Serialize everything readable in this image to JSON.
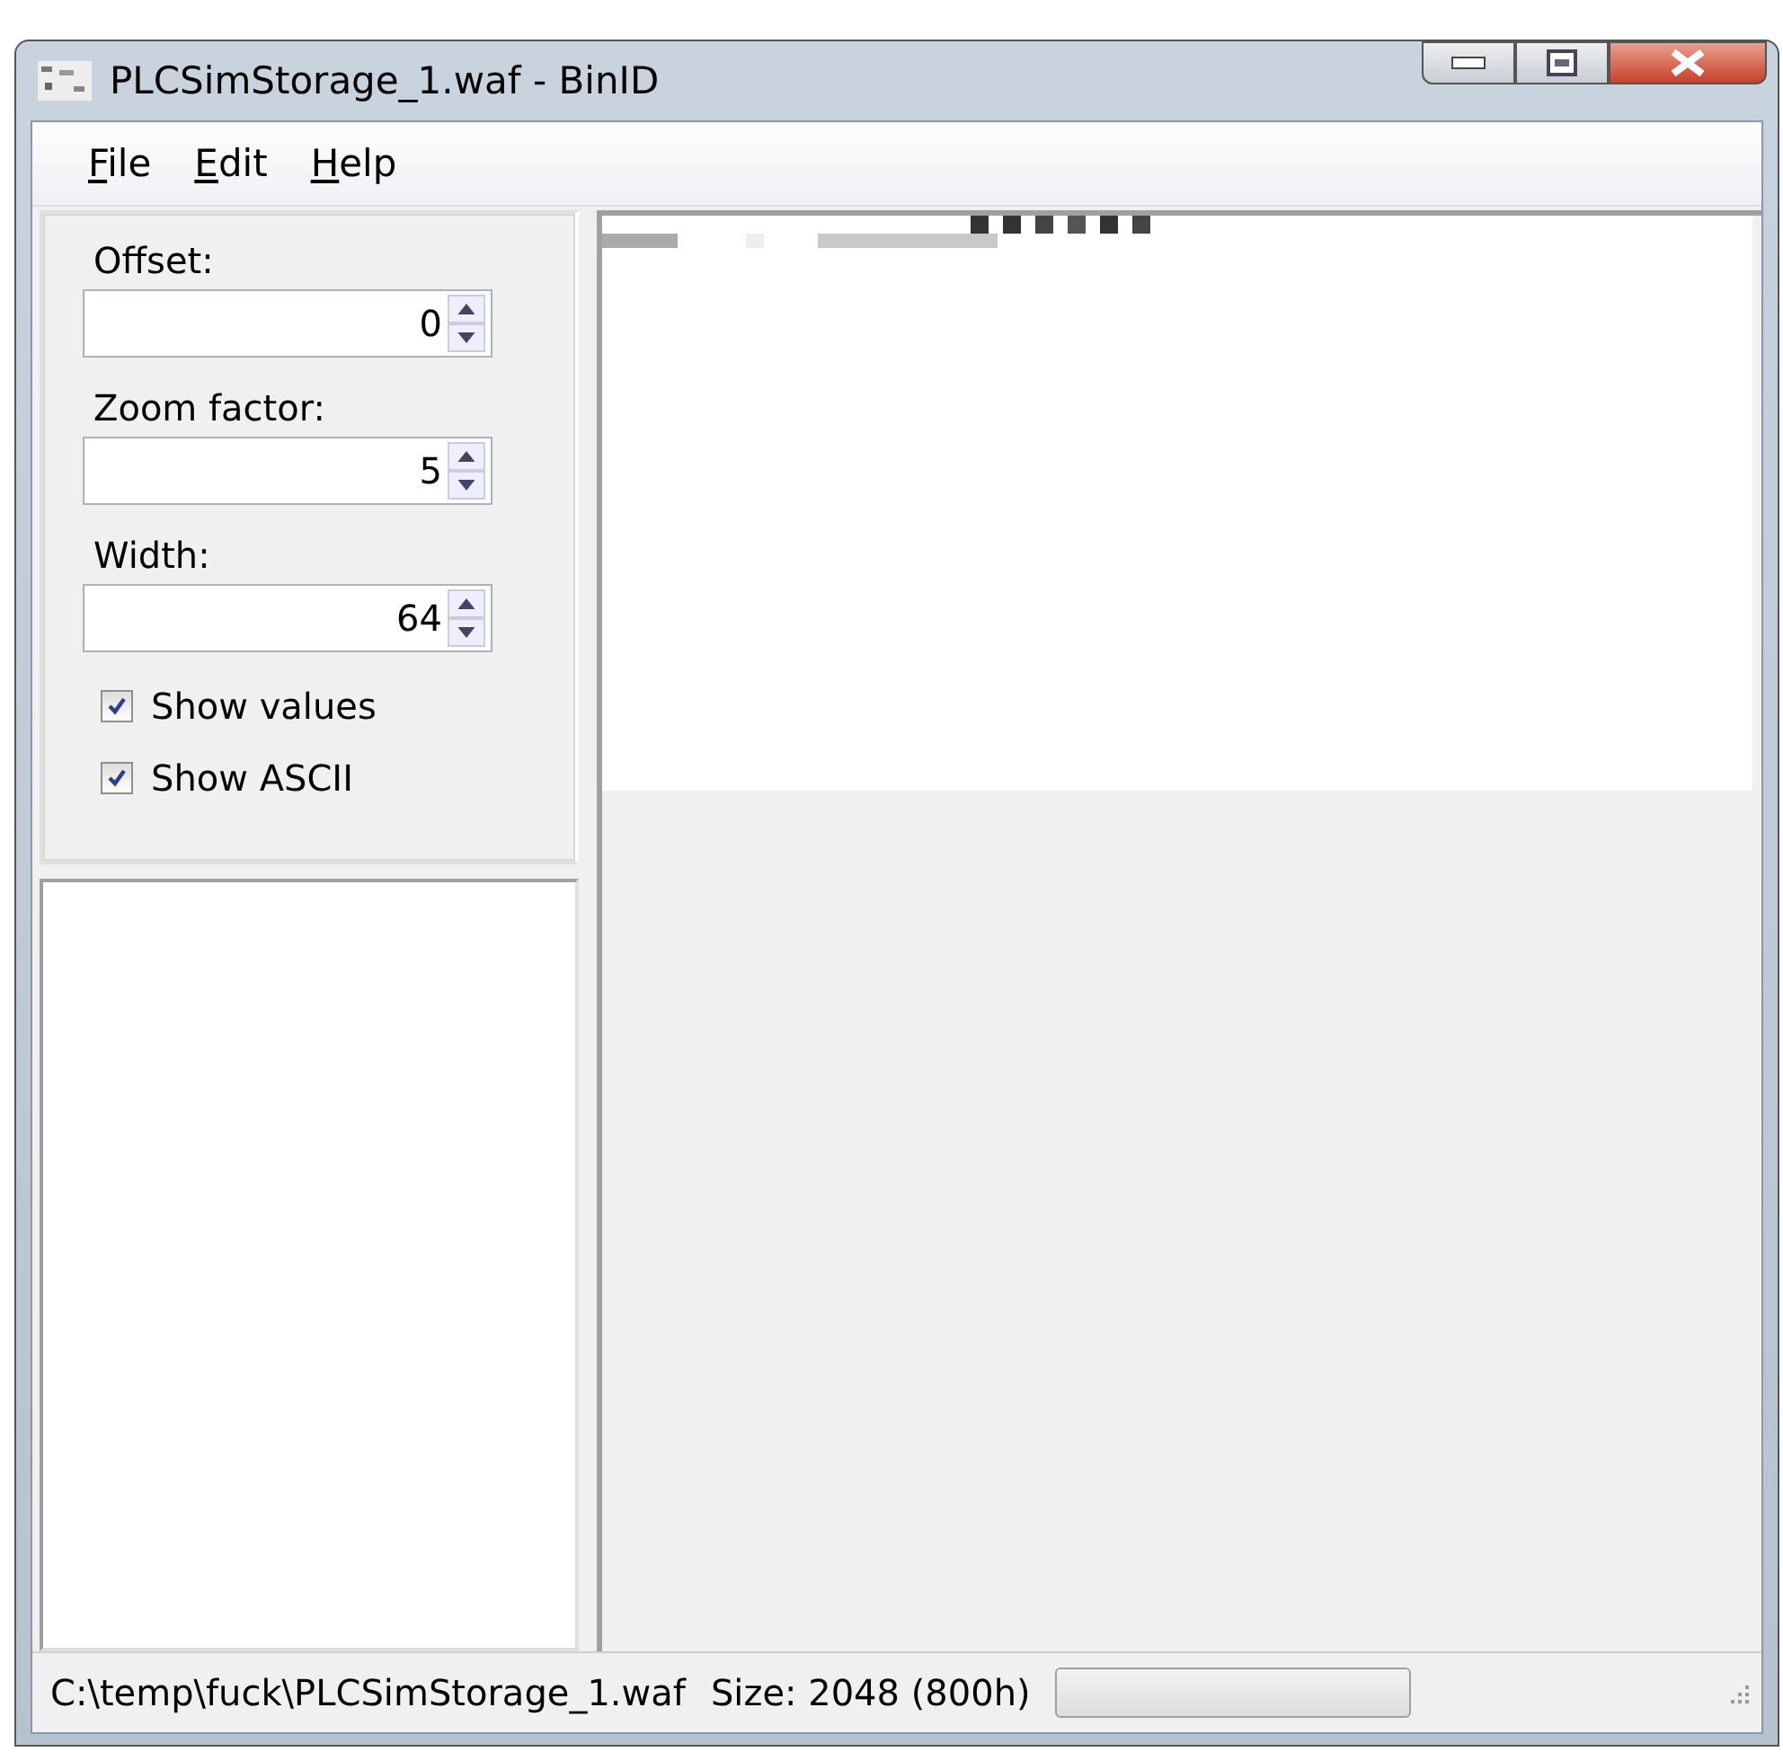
{
  "window": {
    "title": "PLCSimStorage_1.waf - BinID"
  },
  "menu": [
    {
      "label": "File"
    },
    {
      "label": "Edit"
    },
    {
      "label": "Help"
    }
  ],
  "settings": {
    "fields": [
      {
        "label": "Offset:",
        "value": "0"
      },
      {
        "label": "Zoom factor:",
        "value": "5"
      },
      {
        "label": "Width:",
        "value": "64"
      }
    ],
    "checkboxes": [
      {
        "label": "Show values",
        "checked": true
      },
      {
        "label": "Show ASCII",
        "checked": true
      }
    ]
  },
  "status_bar": {
    "path": "C:\\temp\\fuck\\PLCSimStorage_1.waf",
    "size": "Size: 2048 (800h)",
    "progress": {
      "level": 0
    }
  }
}
